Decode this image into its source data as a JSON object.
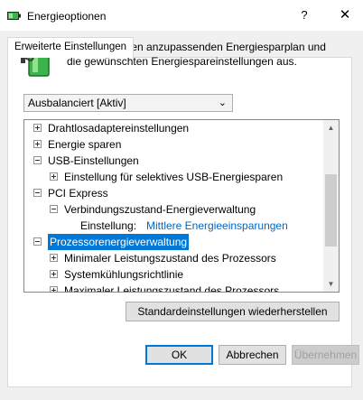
{
  "window": {
    "title": "Energieoptionen",
    "help_glyph": "?",
    "close_glyph": "✕",
    "app_icon": "power-options-icon"
  },
  "tab": {
    "label": "Erweiterte Einstellungen"
  },
  "description": "Wählen Sie den anzupassenden Energiesparplan und die gewünschten Energiespareinstellungen aus.",
  "plan_select": {
    "value": "Ausbalanciert [Aktiv]"
  },
  "tree": {
    "items": [
      {
        "label": "Drahtlosadaptereinstellungen",
        "expander": "+"
      },
      {
        "label": "Energie sparen",
        "expander": "+"
      },
      {
        "label": "USB-Einstellungen",
        "expander": "−"
      },
      {
        "label": "Einstellung für selektives USB-Energiesparen",
        "expander": "+"
      },
      {
        "label": "PCI Express",
        "expander": "−"
      },
      {
        "label": "Verbindungszustand-Energieverwaltung",
        "expander": "−"
      },
      {
        "label": "Einstellung:",
        "value": "Mittlere Energieeinsparungen"
      },
      {
        "label": "Prozessorenergieverwaltung",
        "expander": "−",
        "selected": true
      },
      {
        "label": "Minimaler Leistungszustand des Prozessors",
        "expander": "+"
      },
      {
        "label": "Systemkühlungsrichtlinie",
        "expander": "+"
      },
      {
        "label": "Maximaler Leistungszustand des Prozessors",
        "expander": "+"
      }
    ]
  },
  "buttons": {
    "restore": "Standardeinstellungen wiederherstellen",
    "ok": "OK",
    "cancel": "Abbrechen",
    "apply": "Übernehmen"
  },
  "colors": {
    "selection": "#0078d7",
    "link": "#0066cc",
    "accent_green": "#3cb44b"
  }
}
